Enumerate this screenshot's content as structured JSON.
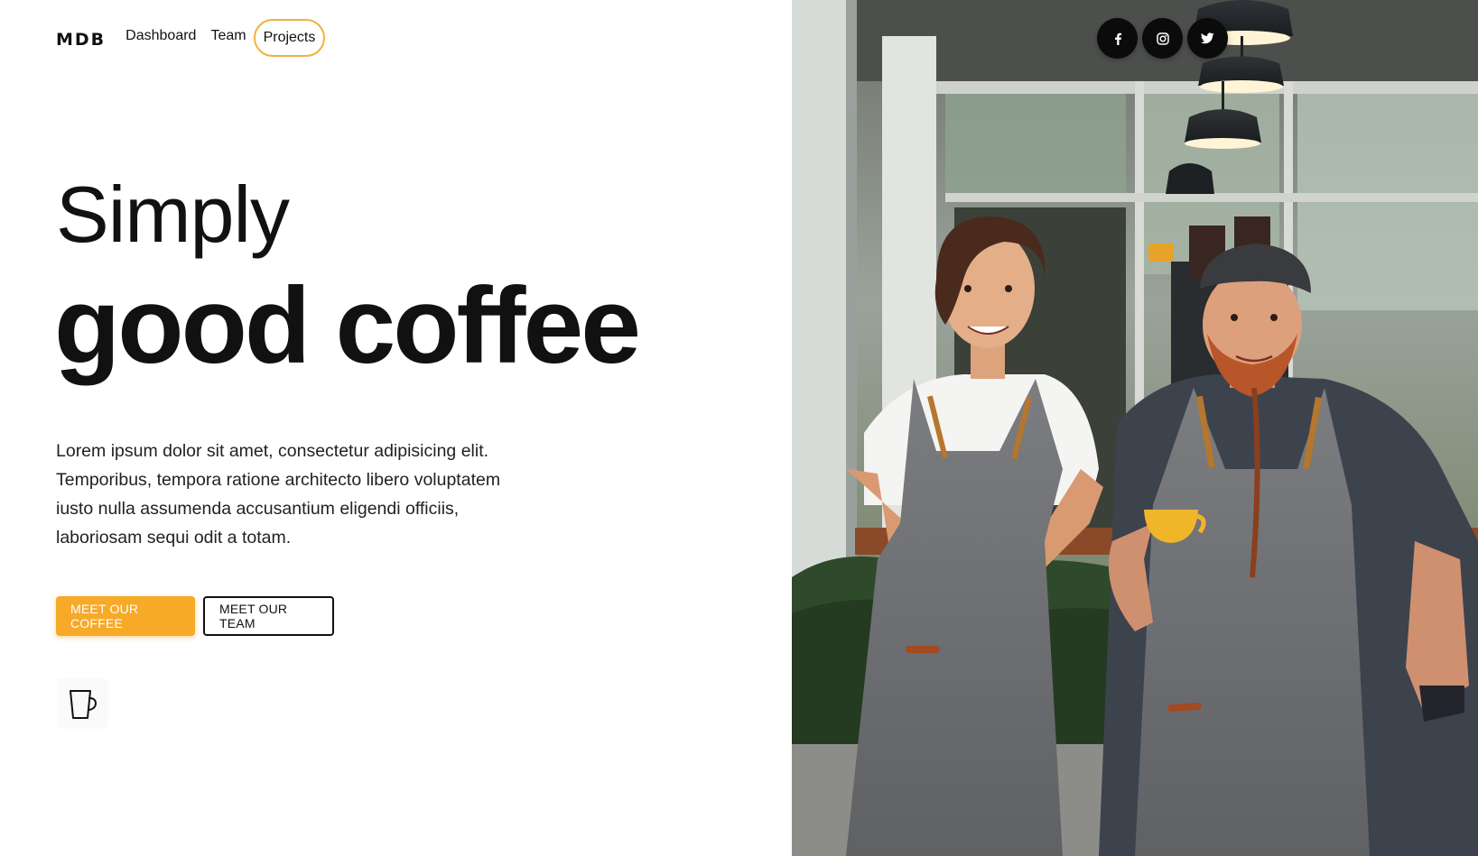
{
  "nav": {
    "logo": "MDB",
    "links": [
      {
        "label": "Dashboard"
      },
      {
        "label": "Team"
      },
      {
        "label": "Projects",
        "active": true
      }
    ]
  },
  "hero": {
    "title_line_1": "Simply",
    "title_line_2": "good coffee",
    "lead": "Lorem ipsum dolor sit amet, consectetur adipisicing elit. Temporibus, tempora ratione architecto libero voluptatem iusto nulla assumenda accusantium eligendi officiis, laboriosam sequi odit a totam.",
    "primary_button": "MEET OUR COFFEE",
    "secondary_button": "MEET OUR TEAM",
    "decor_icon": "coffee-mug-icon"
  },
  "social": [
    {
      "icon": "facebook-icon"
    },
    {
      "icon": "instagram-icon"
    },
    {
      "icon": "twitter-icon"
    }
  ],
  "colors": {
    "accent": "#f7a928",
    "active_link_border": "#f0b23a",
    "text": "#111111",
    "social_bg": "#0b0b0b"
  }
}
